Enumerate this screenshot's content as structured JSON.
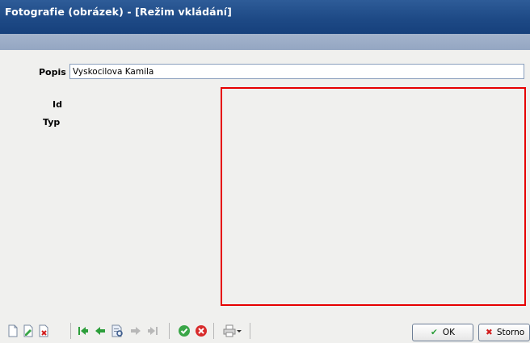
{
  "window": {
    "title": "Fotografie (obrázek) - [Režim vkládání]"
  },
  "form": {
    "popis_label": "Popis",
    "popis_value": "Vyskocilova Kamila",
    "id_label": "Id",
    "typ_label": "Typ"
  },
  "toolbar": {
    "icons": [
      "new-record-icon",
      "edit-record-icon",
      "delete-record-icon",
      "first-record-icon",
      "previous-record-icon",
      "find-record-icon",
      "next-record-icon",
      "last-record-icon",
      "confirm-icon",
      "cancel-icon",
      "print-icon",
      "dropdown-arrow-icon"
    ]
  },
  "buttons": {
    "ok_label": "OK",
    "storno_label": "Storno"
  },
  "colors": {
    "title_bar": "#1e4a86",
    "photo_frame_border": "#e60000",
    "nav_arrow": "#2c9e3a"
  }
}
